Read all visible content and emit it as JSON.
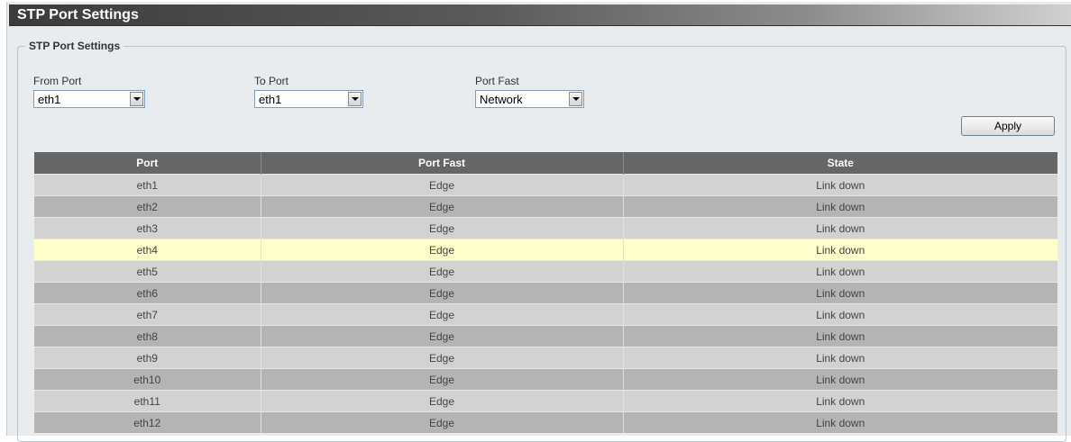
{
  "window": {
    "title": "STP Port Settings"
  },
  "form": {
    "legend": "STP Port Settings",
    "from_port": {
      "label": "From Port",
      "value": "eth1"
    },
    "to_port": {
      "label": "To Port",
      "value": "eth1"
    },
    "port_fast": {
      "label": "Port Fast",
      "value": "Network"
    },
    "apply_label": "Apply"
  },
  "table": {
    "headers": [
      "Port",
      "Port Fast",
      "State"
    ],
    "rows": [
      [
        "eth1",
        "Edge",
        "Link down"
      ],
      [
        "eth2",
        "Edge",
        "Link down"
      ],
      [
        "eth3",
        "Edge",
        "Link down"
      ],
      [
        "eth4",
        "Edge",
        "Link down"
      ],
      [
        "eth5",
        "Edge",
        "Link down"
      ],
      [
        "eth6",
        "Edge",
        "Link down"
      ],
      [
        "eth7",
        "Edge",
        "Link down"
      ],
      [
        "eth8",
        "Edge",
        "Link down"
      ],
      [
        "eth9",
        "Edge",
        "Link down"
      ],
      [
        "eth10",
        "Edge",
        "Link down"
      ],
      [
        "eth11",
        "Edge",
        "Link down"
      ],
      [
        "eth12",
        "Edge",
        "Link down"
      ]
    ],
    "highlighted_row": "eth4"
  },
  "colors": {
    "header_bg": "#666666",
    "row_light": "#d2d2d2",
    "row_dark": "#b4b4b4",
    "row_highlight": "#ffffcc",
    "panel_bg": "#e8ecee"
  }
}
